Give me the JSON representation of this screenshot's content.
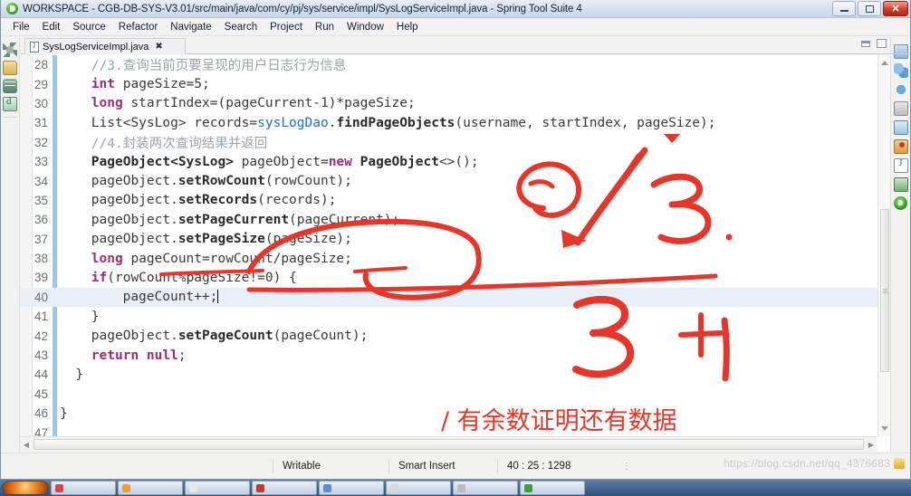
{
  "window": {
    "title": "WORKSPACE - CGB-DB-SYS-V3.01/src/main/java/com/cy/pj/sys/service/impl/SysLogServiceImpl.java - Spring Tool Suite 4",
    "app_icon": "spring-leaf-icon",
    "buttons": {
      "minimize": "minimize-button",
      "restore": "restore-button",
      "close": "✕"
    }
  },
  "menubar": {
    "items": [
      {
        "label": "File"
      },
      {
        "label": "Edit"
      },
      {
        "label": "Source"
      },
      {
        "label": "Refactor"
      },
      {
        "label": "Navigate"
      },
      {
        "label": "Search"
      },
      {
        "label": "Project"
      },
      {
        "label": "Run"
      },
      {
        "label": "Window"
      },
      {
        "label": "Help"
      }
    ]
  },
  "editor": {
    "tab": {
      "label": "SysLogServiceImpl.java",
      "close_glyph": "✖"
    },
    "current_line": 40,
    "lines": [
      {
        "num": "28",
        "indent": 4,
        "tokens": [
          {
            "t": "//3.查询当前页要呈现的用户日志行为信息",
            "c": "cmt"
          }
        ]
      },
      {
        "num": "29",
        "indent": 4,
        "tokens": [
          {
            "t": "int",
            "c": "kw"
          },
          {
            "t": " pageSize=5;",
            "c": "pln"
          }
        ]
      },
      {
        "num": "30",
        "indent": 4,
        "tokens": [
          {
            "t": "long",
            "c": "kw"
          },
          {
            "t": " startIndex=(pageCurrent-1)*pageSize;",
            "c": "pln"
          }
        ]
      },
      {
        "num": "31",
        "indent": 4,
        "tokens": [
          {
            "t": "List<SysLog> records=",
            "c": "pln"
          },
          {
            "t": "sysLogDao",
            "c": "fld"
          },
          {
            "t": ".",
            "c": "pln"
          },
          {
            "t": "findPageObjects",
            "c": "mth"
          },
          {
            "t": "(username, startIndex, pageSize);",
            "c": "pln"
          }
        ]
      },
      {
        "num": "32",
        "indent": 4,
        "tokens": [
          {
            "t": "//4.封装两次查询结果并返回",
            "c": "cmt"
          }
        ]
      },
      {
        "num": "33",
        "indent": 4,
        "tokens": [
          {
            "t": "PageObject<SysLog>",
            "c": "cls"
          },
          {
            "t": " pageObject=",
            "c": "pln"
          },
          {
            "t": "new",
            "c": "kw"
          },
          {
            "t": " ",
            "c": "pln"
          },
          {
            "t": "PageObject",
            "c": "cls"
          },
          {
            "t": "<>();",
            "c": "pln"
          }
        ]
      },
      {
        "num": "34",
        "indent": 4,
        "tokens": [
          {
            "t": "pageObject.",
            "c": "pln"
          },
          {
            "t": "setRowCount",
            "c": "mth"
          },
          {
            "t": "(rowCount);",
            "c": "pln"
          }
        ]
      },
      {
        "num": "35",
        "indent": 4,
        "tokens": [
          {
            "t": "pageObject.",
            "c": "pln"
          },
          {
            "t": "setRecords",
            "c": "mth"
          },
          {
            "t": "(records);",
            "c": "pln"
          }
        ]
      },
      {
        "num": "36",
        "indent": 4,
        "tokens": [
          {
            "t": "pageObject.",
            "c": "pln"
          },
          {
            "t": "setPageCurrent",
            "c": "mth"
          },
          {
            "t": "(pageCurrent);",
            "c": "pln"
          }
        ]
      },
      {
        "num": "37",
        "indent": 4,
        "tokens": [
          {
            "t": "pageObject.",
            "c": "pln"
          },
          {
            "t": "setPageSize",
            "c": "mth"
          },
          {
            "t": "(pageSize);",
            "c": "pln"
          }
        ]
      },
      {
        "num": "38",
        "indent": 4,
        "tokens": [
          {
            "t": "long",
            "c": "kw"
          },
          {
            "t": " pageCount=rowCount/pageSize;",
            "c": "pln"
          }
        ]
      },
      {
        "num": "39",
        "indent": 4,
        "tokens": [
          {
            "t": "if",
            "c": "kw"
          },
          {
            "t": "(rowCount%pageSize!=0) {",
            "c": "pln"
          }
        ]
      },
      {
        "num": "40",
        "indent": 8,
        "tokens": [
          {
            "t": "pageCount++;",
            "c": "pln"
          }
        ],
        "caret": true,
        "current": true
      },
      {
        "num": "41",
        "indent": 4,
        "tokens": [
          {
            "t": "}",
            "c": "pln"
          }
        ]
      },
      {
        "num": "42",
        "indent": 4,
        "tokens": [
          {
            "t": "pageObject.",
            "c": "pln"
          },
          {
            "t": "setPageCount",
            "c": "mth"
          },
          {
            "t": "(pageCount);",
            "c": "pln"
          }
        ]
      },
      {
        "num": "43",
        "indent": 4,
        "tokens": [
          {
            "t": "return",
            "c": "kw"
          },
          {
            "t": " ",
            "c": "pln"
          },
          {
            "t": "null",
            "c": "kw"
          },
          {
            "t": ";",
            "c": "pln"
          }
        ]
      },
      {
        "num": "44",
        "indent": 2,
        "tokens": [
          {
            "t": "}",
            "c": "pln"
          }
        ]
      },
      {
        "num": "45",
        "indent": 0,
        "tokens": []
      },
      {
        "num": "46",
        "indent": 0,
        "tokens": [
          {
            "t": "}",
            "c": "pln"
          }
        ]
      },
      {
        "num": "47",
        "indent": 0,
        "tokens": []
      }
    ]
  },
  "annotations": {
    "handwritten": [
      {
        "name": "circled-zero",
        "text": ""
      },
      {
        "name": "slash-stroke",
        "text": "/"
      },
      {
        "name": "digit-three-top",
        "text": "3"
      },
      {
        "name": "digit-three-bottom",
        "text": "3"
      },
      {
        "name": "plus-one",
        "text": "+1"
      }
    ],
    "chinese_note": "/ 有余数证明还有数据",
    "ink_color": "#e8352a"
  },
  "statusbar": {
    "writable": "Writable",
    "insert_mode": "Smart Insert",
    "position": "40 : 25 : 1298",
    "overflow_dots": "⋮"
  },
  "watermark": {
    "text": "https://blog.csdn.net/qq_4376683"
  },
  "left_rail": {
    "icons": [
      "gear-icon",
      "package-explorer-icon",
      "database-icon",
      "java-doc-icon"
    ]
  },
  "right_rail": {
    "icons": [
      "outline-icon",
      "beans-graph-icon",
      "spring-explorer-icon",
      "printer-icon",
      "console-icon",
      "problems-icon",
      "javadoc-icon",
      "download-icon",
      "boot-dashboard-icon"
    ]
  }
}
